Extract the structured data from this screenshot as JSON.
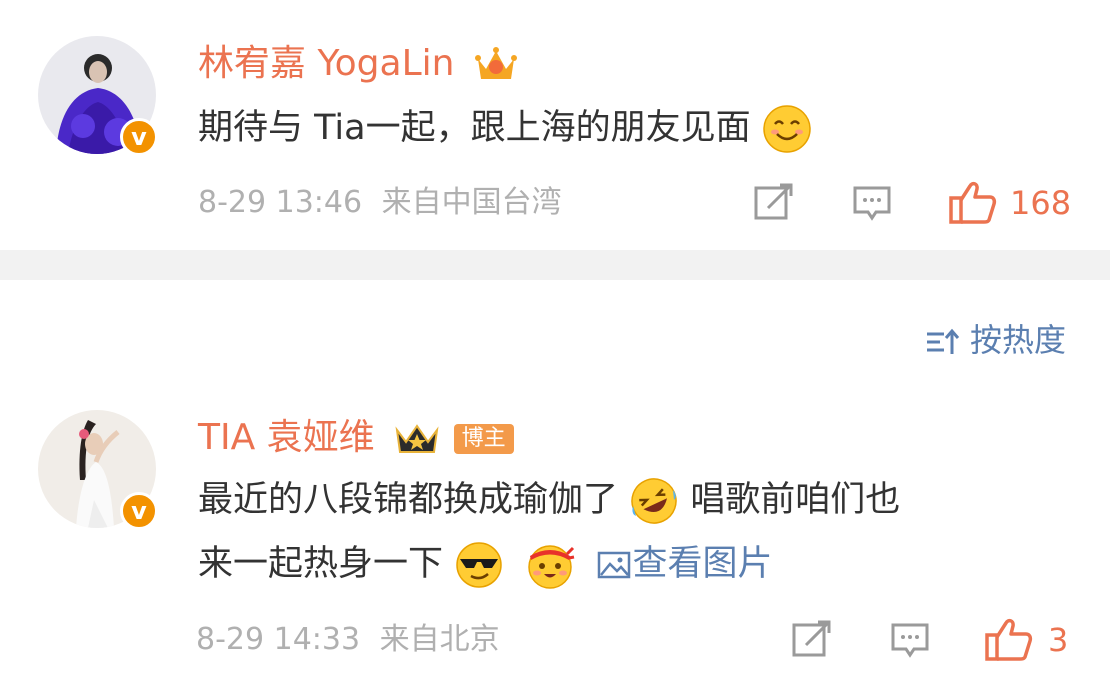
{
  "post1": {
    "username": "林宥嘉 YogaLin",
    "content": "期待与 Tia一起，跟上海的朋友见面",
    "time": "8-29 13:46",
    "source": "来自中国台湾",
    "likes": "168",
    "emoji": "smiling-face"
  },
  "sort": {
    "label": "按热度",
    "icon": "sort-icon"
  },
  "post2": {
    "username": "TIA 袁娅维",
    "author_tag": "博主",
    "content_line1": "最近的八段锦都换成瑜伽了",
    "content_line1_after": "唱歌前咱们也",
    "content_line2": "来一起热身一下",
    "view_image": "查看图片",
    "time": "8-29 14:33",
    "source": "来自北京",
    "likes": "3"
  },
  "colors": {
    "accent": "#eb7350",
    "link": "#5b7fb0",
    "verified": "#f39200",
    "divider": "#f2f2f2"
  }
}
